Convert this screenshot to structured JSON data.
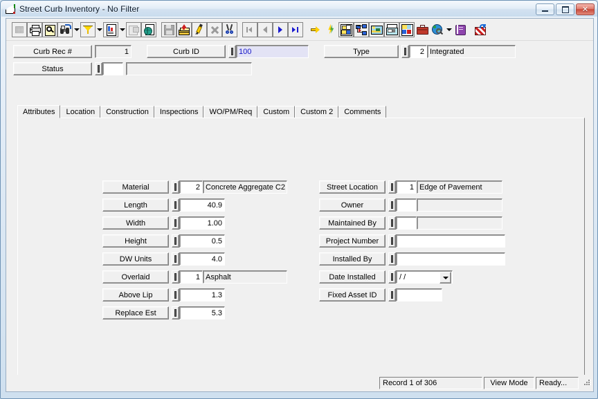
{
  "window": {
    "title": "Street Curb Inventory - No Filter",
    "app_icon": "curb-ramp-icon",
    "minimize_label": "",
    "maximize_label": "",
    "close_label": "✕"
  },
  "toolbar": {
    "groups": [
      {
        "buttons": [
          {
            "name": "grid-view-button",
            "icon": "grid-icon",
            "disabled": true
          },
          {
            "name": "print-button",
            "icon": "printer-icon",
            "disabled": false
          },
          {
            "name": "print-preview-button",
            "icon": "print-preview-icon",
            "disabled": false
          },
          {
            "name": "find-button",
            "icon": "binoculars-icon",
            "disabled": false,
            "dropdown": true
          },
          {
            "name": "filter-button",
            "icon": "funnel-icon",
            "disabled": false,
            "dropdown": true
          },
          {
            "name": "report-button",
            "icon": "report-icon",
            "disabled": false,
            "dropdown": true
          },
          {
            "name": "properties-button",
            "icon": "properties-icon",
            "disabled": true
          },
          {
            "name": "export-button",
            "icon": "globe-page-icon",
            "disabled": false
          }
        ]
      },
      {
        "buttons": [
          {
            "name": "save-button",
            "icon": "floppy-disk-icon",
            "disabled": true
          },
          {
            "name": "add-record-button",
            "icon": "add-stack-icon",
            "disabled": false
          },
          {
            "name": "edit-record-button",
            "icon": "pencil-icon",
            "disabled": false
          },
          {
            "name": "delete-record-button",
            "icon": "delete-x-icon",
            "disabled": true
          },
          {
            "name": "cut-button",
            "icon": "scissors-icon",
            "disabled": false
          }
        ]
      },
      {
        "buttons": [
          {
            "name": "first-record-button",
            "icon": "first-record-icon",
            "disabled": true
          },
          {
            "name": "previous-record-button",
            "icon": "previous-record-icon",
            "disabled": true
          },
          {
            "name": "next-record-button",
            "icon": "next-record-icon",
            "disabled": false
          },
          {
            "name": "last-record-button",
            "icon": "last-record-icon",
            "disabled": false
          }
        ]
      },
      {
        "buttons": [
          {
            "name": "goto-button",
            "icon": "yellow-arrow-icon",
            "disabled": false
          },
          {
            "name": "quick-action-button",
            "icon": "lightning-bolt-icon",
            "disabled": false
          },
          {
            "name": "map-button",
            "icon": "map-gis-icon",
            "disabled": false
          },
          {
            "name": "tree-view-button",
            "icon": "hierarchy-tree-icon",
            "disabled": false
          },
          {
            "name": "image-button",
            "icon": "picture-icon",
            "disabled": false
          },
          {
            "name": "fax-button",
            "icon": "fax-machine-icon",
            "disabled": false
          },
          {
            "name": "gallery-button",
            "icon": "photo-gallery-icon",
            "disabled": false
          },
          {
            "name": "briefcase-button",
            "icon": "briefcase-icon",
            "disabled": false
          },
          {
            "name": "web-search-button",
            "icon": "globe-magnifier-icon",
            "disabled": false,
            "dropdown": true
          },
          {
            "name": "help-book-button",
            "icon": "purple-book-icon",
            "disabled": false
          }
        ]
      },
      {
        "buttons": [
          {
            "name": "exit-button",
            "icon": "exit-door-icon",
            "disabled": false
          }
        ]
      }
    ]
  },
  "header": {
    "curb_rec": {
      "label": "Curb Rec #",
      "value": "1"
    },
    "curb_id": {
      "label": "Curb ID",
      "value": "100"
    },
    "type": {
      "label": "Type",
      "code": "2",
      "value": "Integrated"
    },
    "status": {
      "label": "Status",
      "code": "",
      "value": ""
    }
  },
  "tabs": [
    {
      "label": "Attributes",
      "active": true
    },
    {
      "label": "Location",
      "active": false
    },
    {
      "label": "Construction",
      "active": false
    },
    {
      "label": "Inspections",
      "active": false
    },
    {
      "label": "WO/PM/Req",
      "active": false
    },
    {
      "label": "Custom",
      "active": false
    },
    {
      "label": "Custom 2",
      "active": false
    },
    {
      "label": "Comments",
      "active": false
    }
  ],
  "attributes": {
    "left_column": [
      {
        "label": "Material",
        "code": "2",
        "value": "Concrete Aggregate C2",
        "kind": "code-desc"
      },
      {
        "label": "Length",
        "code": "",
        "value": "40.9",
        "kind": "number"
      },
      {
        "label": "Width",
        "code": "",
        "value": "1.00",
        "kind": "number"
      },
      {
        "label": "Height",
        "code": "",
        "value": "0.5",
        "kind": "number"
      },
      {
        "label": "DW Units",
        "code": "",
        "value": "4.0",
        "kind": "number"
      },
      {
        "label": "Overlaid",
        "code": "1",
        "value": "Asphalt",
        "kind": "code-desc"
      },
      {
        "label": "Above Lip",
        "code": "",
        "value": "1.3",
        "kind": "number"
      },
      {
        "label": "Replace Est",
        "code": "",
        "value": "5.3",
        "kind": "number"
      }
    ],
    "right_column": [
      {
        "label": "Street Location",
        "code": "1",
        "value": "Edge of Pavement",
        "kind": "code-desc"
      },
      {
        "label": "Owner",
        "code": "",
        "value": "",
        "kind": "code-desc"
      },
      {
        "label": "Maintained By",
        "code": "",
        "value": "",
        "kind": "code-desc"
      },
      {
        "label": "Project Number",
        "code": "",
        "value": "",
        "kind": "text"
      },
      {
        "label": "Installed By",
        "code": "",
        "value": "",
        "kind": "text"
      },
      {
        "label": "Date Installed",
        "code": "",
        "value": "  /  /",
        "kind": "date"
      },
      {
        "label": "Fixed Asset ID",
        "code": "",
        "value": "",
        "kind": "short-text"
      }
    ]
  },
  "statusbar": {
    "record": "Record 1 of 306",
    "mode": "View Mode",
    "state": "Ready..."
  }
}
